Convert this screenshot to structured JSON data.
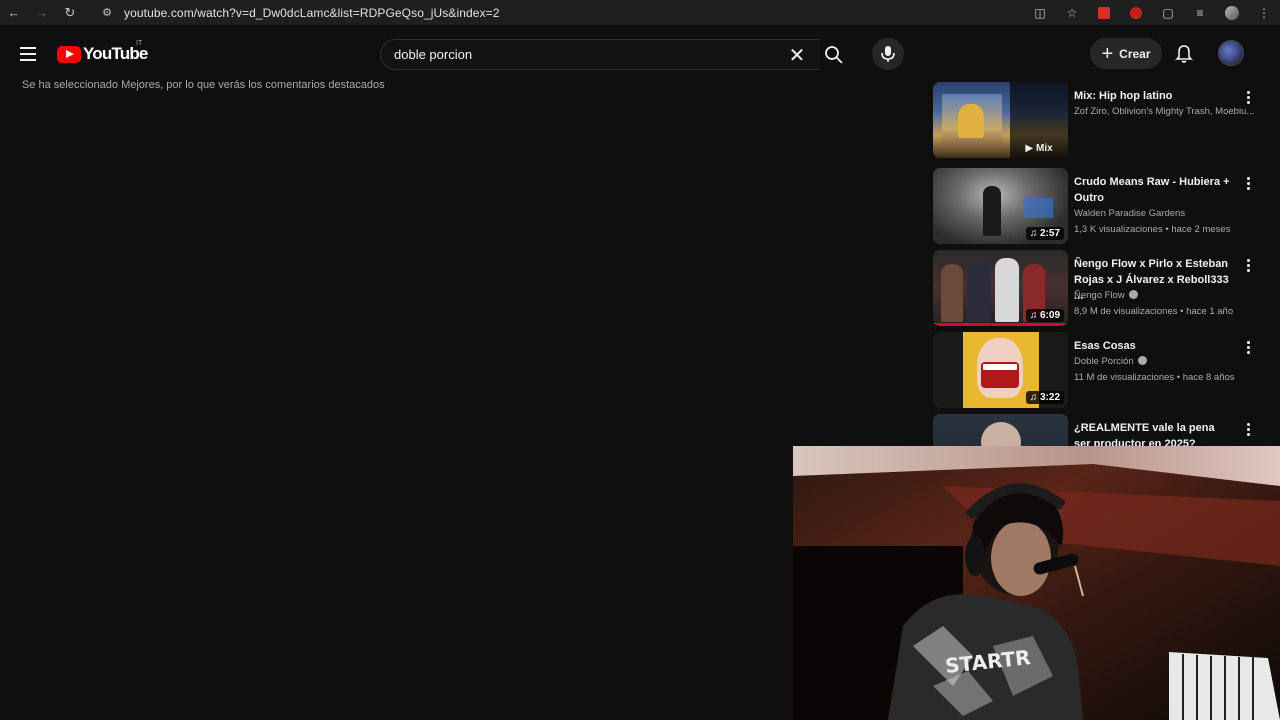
{
  "browser": {
    "url": "youtube.com/watch?v=d_Dw0dcLamc&list=RDPGeQso_jUs&index=2",
    "icons": [
      "back-icon",
      "forward-icon",
      "reload-icon",
      "site-info-icon",
      "install-icon",
      "bookmark-star-icon",
      "extension-icon",
      "extension-icon",
      "extensions-puzzle-icon",
      "media-control-icon",
      "profile-icon",
      "menu-icon"
    ]
  },
  "header": {
    "logo_text": "YouTube",
    "country_code": "IT",
    "search_value": "doble porcion",
    "create_label": "Crear"
  },
  "comments_note": "Se ha seleccionado Mejores, por lo que verás los comentarios destacados",
  "recommendations": [
    {
      "title": "Mix: Hip hop latino",
      "channel": "Zof Ziro, Oblivion's Mighty Trash, Moebiu...",
      "meta": "",
      "badge": "Mix",
      "verified": false
    },
    {
      "title": "Crudo Means Raw - Hubiera + Outro",
      "channel": "Walden Paradise Gardens",
      "meta": "1,3 K visualizaciones • hace 2 meses",
      "badge": "2:57",
      "verified": false
    },
    {
      "title": "Ñengo Flow x Pirlo x Esteban Rojas x J Álvarez x Reboll333 ...",
      "channel": "Ñengo Flow",
      "meta": "8,9 M de visualizaciones • hace 1 año",
      "badge": "6:09",
      "verified": true
    },
    {
      "title": "Esas Cosas",
      "channel": "Doble Porción",
      "meta": "11 M de visualizaciones • hace 8 años",
      "badge": "3:22",
      "verified": true
    },
    {
      "title": "¿REALMENTE vale la pena ser productor en 2025?",
      "channel": "",
      "meta": "",
      "badge": "",
      "verified": false
    }
  ],
  "webcam": {
    "shirt_text": "STARTR"
  }
}
